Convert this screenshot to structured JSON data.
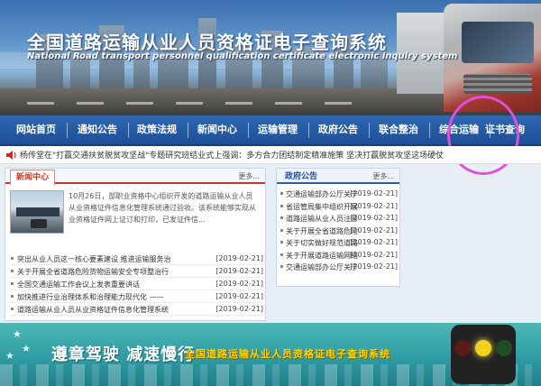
{
  "banner": {
    "title": "全国道路运输从业人员资格证电子查询系统",
    "subtitle": "National Road transport personnel qualification certificate electronic inquiry system"
  },
  "nav": {
    "items": [
      {
        "label": "网站首页"
      },
      {
        "label": "通知公告"
      },
      {
        "label": "政策法规"
      },
      {
        "label": "新闻中心"
      },
      {
        "label": "运输管理"
      },
      {
        "label": "政府公告"
      },
      {
        "label": "联合整治"
      },
      {
        "label": "综合运输"
      },
      {
        "label": "证书查询"
      }
    ],
    "highlight_color": "#e24fd8"
  },
  "ticker": {
    "text": "杨传堂在\"打赢交通扶贫脱贫攻坚战\"专题研究班结业式上强调：多方合力团结制定精准施策 坚决打赢脱贫攻坚这场硬仗"
  },
  "news_panel": {
    "tab_label": "新闻中心",
    "more_label": "更多...",
    "feature_text": "10月26日，部职业资格中心组织开发的道路运输从业人员从业资格证件信息化管理系统通过验收。该系统能够实现从业资格证件网上证订和打印，已发证件信...",
    "items": [
      {
        "title": "突出从业人员这一核心要素建设 推进运输服务治",
        "date": "[2019-02-21]"
      },
      {
        "title": "关于开展全省道路危险货物运输安全专项整治行",
        "date": "[2019-02-21]"
      },
      {
        "title": "全国交通运输工作会议上发表重要讲话",
        "date": "[2019-02-21]"
      },
      {
        "title": "加快推进行业治理体系和治理能力现代化 ——",
        "date": "[2019-02-21]"
      },
      {
        "title": "道路运输从业人员从业资格证件信息化管理系统",
        "date": "[2019-02-21]"
      }
    ]
  },
  "notice_panel": {
    "tab_label": "政府公告",
    "more_label": "更多...",
    "items": [
      {
        "title": "交通运输部办公厅关于",
        "date": "[2019-02-21]"
      },
      {
        "title": "省运管局集中组织开展",
        "date": "[2019-02-21]"
      },
      {
        "title": "道路运输从业人员注意",
        "date": "[2019-02-21]"
      },
      {
        "title": "关于开展全省道路危险",
        "date": "[2019-02-21]"
      },
      {
        "title": "关于切实做好规范道路",
        "date": "[2019-02-21]"
      },
      {
        "title": "关于开展道路运输网络",
        "date": "[2019-02-21]"
      },
      {
        "title": "交通运输部办公厅关于",
        "date": "[2019-02-21]"
      }
    ]
  },
  "ad": {
    "slogan": "遵章驾驶  减速慢行",
    "system_name": "全国道路运输从业人员资格证电子查询系统"
  }
}
